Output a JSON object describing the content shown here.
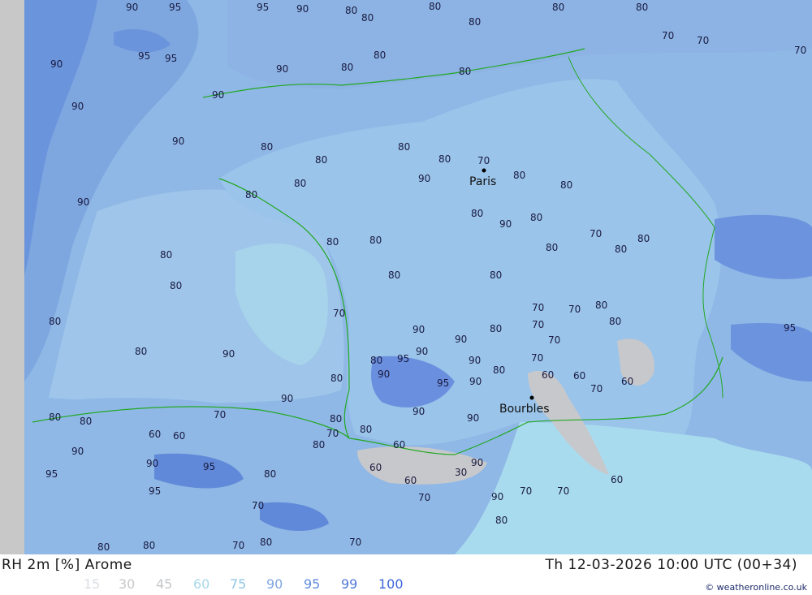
{
  "header": {
    "title": "RH 2m [%] Arome",
    "valid_time": "Th 12-03-2026 10:00 UTC (00+34)"
  },
  "legend": {
    "items": [
      {
        "label": "15",
        "color": "#d9dde3"
      },
      {
        "label": "30",
        "color": "#c5c7ca"
      },
      {
        "label": "45",
        "color": "#c5c7ca"
      },
      {
        "label": "60",
        "color": "#a8d8e8"
      },
      {
        "label": "75",
        "color": "#8ec7e6"
      },
      {
        "label": "90",
        "color": "#7fa6e0"
      },
      {
        "label": "95",
        "color": "#5f8cdc"
      },
      {
        "label": "99",
        "color": "#4f78d8"
      },
      {
        "label": "100",
        "color": "#3c66d8"
      }
    ]
  },
  "credit": "© weatheronline.co.uk",
  "cities": [
    {
      "name": "Paris",
      "label": "Paris"
    },
    {
      "name": "Bourbles",
      "label": "Bourbles"
    }
  ],
  "contour_labels": [
    {
      "v": "90"
    },
    {
      "v": "95"
    },
    {
      "v": "95"
    },
    {
      "v": "90"
    },
    {
      "v": "80"
    },
    {
      "v": "80"
    },
    {
      "v": "80"
    },
    {
      "v": "80"
    },
    {
      "v": "80"
    },
    {
      "v": "80"
    },
    {
      "v": "95"
    },
    {
      "v": "95"
    },
    {
      "v": "90"
    },
    {
      "v": "90"
    },
    {
      "v": "80"
    },
    {
      "v": "80"
    },
    {
      "v": "80"
    },
    {
      "v": "70"
    },
    {
      "v": "70"
    },
    {
      "v": "70"
    },
    {
      "v": "90"
    },
    {
      "v": "90"
    },
    {
      "v": "90"
    },
    {
      "v": "80"
    },
    {
      "v": "80"
    },
    {
      "v": "80"
    },
    {
      "v": "80"
    },
    {
      "v": "70"
    },
    {
      "v": "80"
    },
    {
      "v": "80"
    },
    {
      "v": "90"
    },
    {
      "v": "80"
    },
    {
      "v": "80"
    },
    {
      "v": "80"
    },
    {
      "v": "80"
    },
    {
      "v": "70"
    },
    {
      "v": "80"
    },
    {
      "v": "80"
    },
    {
      "v": "90"
    },
    {
      "v": "80"
    },
    {
      "v": "80"
    },
    {
      "v": "80"
    },
    {
      "v": "80"
    },
    {
      "v": "90"
    },
    {
      "v": "80"
    },
    {
      "v": "90"
    },
    {
      "v": "70"
    },
    {
      "v": "80"
    },
    {
      "v": "90"
    },
    {
      "v": "80"
    },
    {
      "v": "80"
    },
    {
      "v": "90"
    },
    {
      "v": "80"
    },
    {
      "v": "80"
    },
    {
      "v": "70"
    },
    {
      "v": "70"
    },
    {
      "v": "70"
    },
    {
      "v": "80"
    },
    {
      "v": "90"
    },
    {
      "v": "95"
    },
    {
      "v": "80"
    },
    {
      "v": "80"
    },
    {
      "v": "80"
    },
    {
      "v": "90"
    },
    {
      "v": "95"
    },
    {
      "v": "90"
    },
    {
      "v": "90"
    },
    {
      "v": "80"
    },
    {
      "v": "60"
    },
    {
      "v": "60"
    },
    {
      "v": "70"
    },
    {
      "v": "60"
    },
    {
      "v": "80"
    },
    {
      "v": "70"
    },
    {
      "v": "70"
    },
    {
      "v": "90"
    },
    {
      "v": "95"
    },
    {
      "v": "90"
    },
    {
      "v": "90"
    },
    {
      "v": "80"
    },
    {
      "v": "80"
    },
    {
      "v": "80"
    },
    {
      "v": "90"
    },
    {
      "v": "60"
    },
    {
      "v": "60"
    },
    {
      "v": "70"
    },
    {
      "v": "70"
    },
    {
      "v": "60"
    },
    {
      "v": "90"
    },
    {
      "v": "80"
    },
    {
      "v": "95"
    },
    {
      "v": "95"
    },
    {
      "v": "90"
    },
    {
      "v": "80"
    },
    {
      "v": "60"
    },
    {
      "v": "30"
    },
    {
      "v": "60"
    },
    {
      "v": "70"
    },
    {
      "v": "70"
    },
    {
      "v": "60"
    },
    {
      "v": "70"
    },
    {
      "v": "80"
    },
    {
      "v": "80"
    },
    {
      "v": "70"
    },
    {
      "v": "70"
    },
    {
      "v": "80"
    },
    {
      "v": "90"
    },
    {
      "v": "80"
    },
    {
      "v": "70"
    },
    {
      "v": "95"
    }
  ]
}
